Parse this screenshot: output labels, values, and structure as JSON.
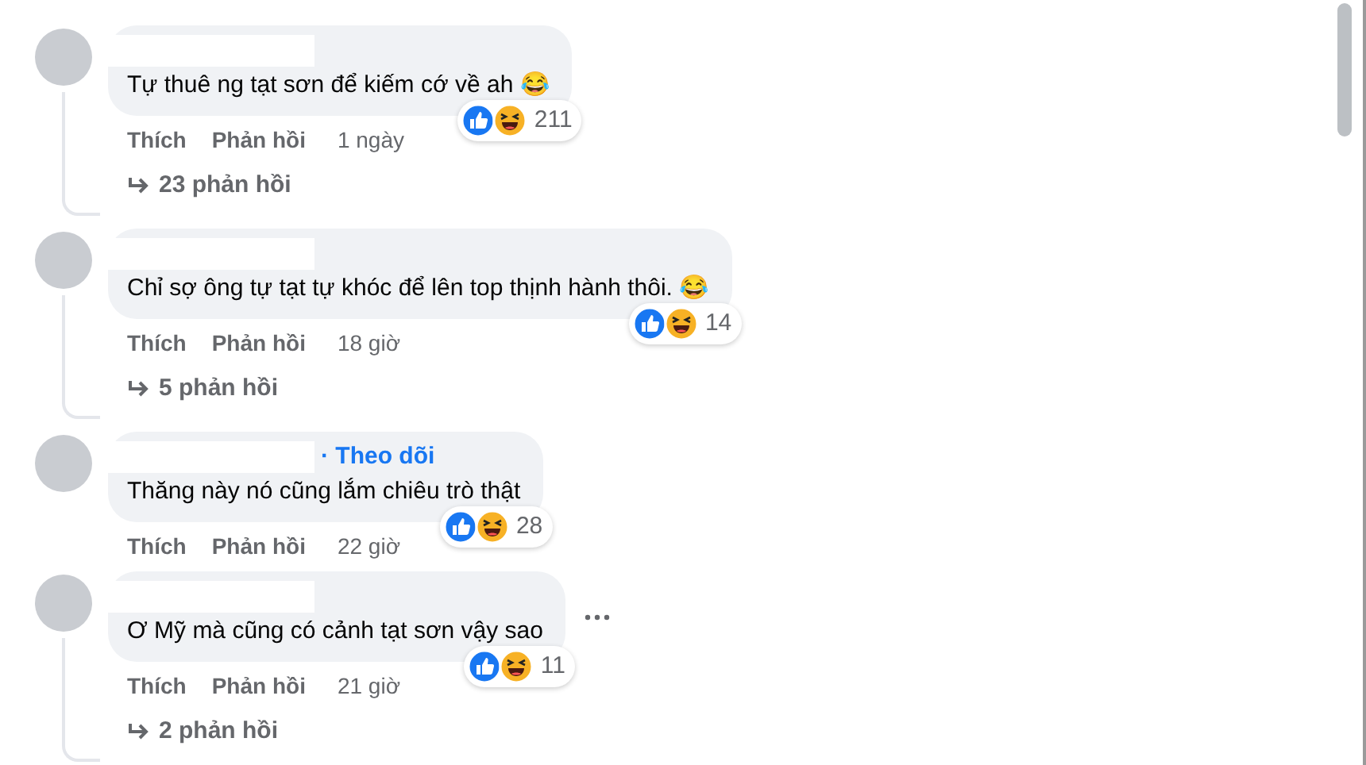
{
  "comments": [
    {
      "text": "Tự thuê ng tạt sơn để kiếm cớ về ah 😂",
      "reaction_count": "211",
      "actions": [
        "Thích",
        "Phản hồi"
      ],
      "time": "1 ngày",
      "replies_label": "23 phản hồi",
      "more_menu": false
    },
    {
      "text": "Chỉ sợ ông tự tạt tự khóc để lên top thịnh hành thôi. 😂",
      "reaction_count": "14",
      "actions": [
        "Thích",
        "Phản hồi"
      ],
      "time": "18 giờ",
      "replies_label": "5 phản hồi",
      "more_menu": false
    },
    {
      "text": "Thăng này nó cũng lắm chiêu trò thật",
      "follow_label": "· Theo dõi",
      "reaction_count": "28",
      "actions": [
        "Thích",
        "Phản hồi"
      ],
      "time": "22 giờ",
      "more_menu": false
    },
    {
      "text": "Ơ Mỹ mà cũng có cảnh tạt sơn vậy sao",
      "reaction_count": "11",
      "actions": [
        "Thích",
        "Phản hồi"
      ],
      "time": "21 giờ",
      "replies_label": "2 phản hồi",
      "more_menu": true
    }
  ]
}
